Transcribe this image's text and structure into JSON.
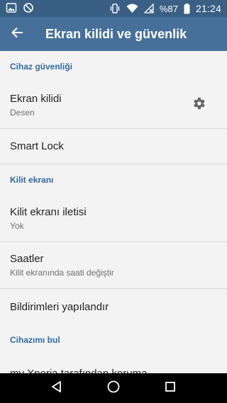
{
  "status_bar": {
    "battery_text": "%87",
    "time": "21:24",
    "icons": [
      "image-icon",
      "blocked-icon",
      "vibrate-icon",
      "wifi-icon",
      "no-signal-icon",
      "battery-icon"
    ]
  },
  "header": {
    "title": "Ekran kilidi ve güvenlik",
    "back_icon": "back-arrow-icon"
  },
  "sections": [
    {
      "header": "Cihaz güvenliği",
      "items": [
        {
          "title": "Ekran kilidi",
          "subtitle": "Desen",
          "has_gear": true
        },
        {
          "title": "Smart Lock",
          "subtitle": "",
          "has_gear": false
        }
      ]
    },
    {
      "header": "Kilit ekranı",
      "items": [
        {
          "title": "Kilit ekranı iletisi",
          "subtitle": "Yok"
        },
        {
          "title": "Saatler",
          "subtitle": "Kilit ekranında saati değiştir"
        },
        {
          "title": "Bildirimleri yapılandır",
          "subtitle": ""
        }
      ]
    },
    {
      "header": "Cihazımı bul",
      "items": [
        {
          "title": "my Xperia tarafından koruma",
          "subtitle": ""
        }
      ]
    }
  ],
  "nav_bar": {
    "icons": [
      "back-triangle-icon",
      "home-circle-icon",
      "recents-square-icon"
    ]
  },
  "colors": {
    "statusbar": "#3a5f84",
    "appbar": "#46709a",
    "section_header": "#2f6aa0",
    "background": "#f3f3f3"
  }
}
